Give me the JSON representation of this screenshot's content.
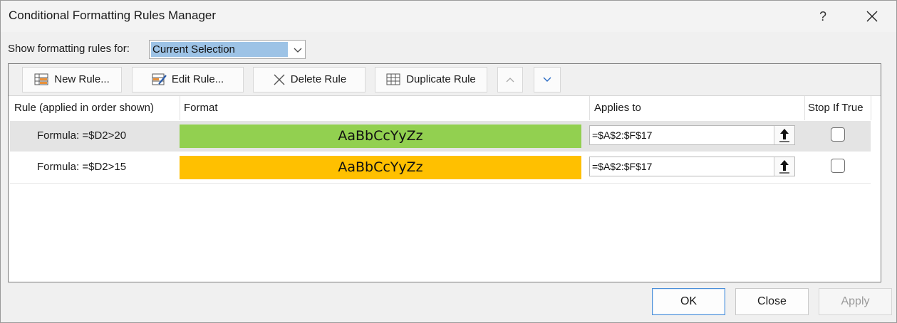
{
  "window": {
    "title": "Conditional Formatting Rules Manager",
    "help_label": "?"
  },
  "filter": {
    "label": "Show formatting rules for:",
    "selected": "Current Selection"
  },
  "toolbar": {
    "new_rule": "New Rule...",
    "edit_rule": "Edit Rule...",
    "delete_rule": "Delete Rule",
    "duplicate_rule": "Duplicate Rule"
  },
  "table": {
    "headers": {
      "rule": "Rule (applied in order shown)",
      "format": "Format",
      "applies_to": "Applies to",
      "stop_if_true": "Stop If True"
    },
    "rows": [
      {
        "rule": "Formula: =$D2>20",
        "preview": "AaBbCcYyZz",
        "color": "#92d050",
        "applies_to": "=$A$2:$F$17",
        "stop_if_true": false,
        "selected": true
      },
      {
        "rule": "Formula: =$D2>15",
        "preview": "AaBbCcYyZz",
        "color": "#ffc000",
        "applies_to": "=$A$2:$F$17",
        "stop_if_true": false,
        "selected": false
      }
    ]
  },
  "footer": {
    "ok": "OK",
    "close": "Close",
    "apply": "Apply"
  }
}
